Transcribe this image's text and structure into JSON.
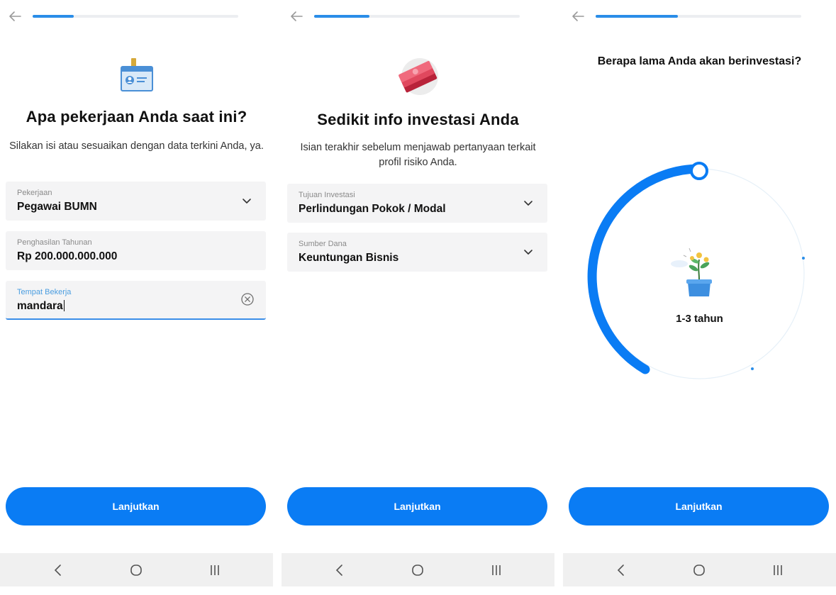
{
  "colors": {
    "accent": "#0a7cf4",
    "progress_fill": "#2a8de8",
    "progress_track": "#eceef1",
    "field_bg": "#f4f4f5",
    "navbar_bg": "#f0f0f0"
  },
  "screen1": {
    "progress": 0.2,
    "illustration": "id-card-icon",
    "title": "Apa pekerjaan Anda saat ini?",
    "subtitle": "Silakan isi atau sesuaikan dengan data terkini Anda, ya.",
    "fields": [
      {
        "label": "Pekerjaan",
        "value": "Pegawai BUMN",
        "type": "dropdown"
      },
      {
        "label": "Penghasilan Tahunan",
        "value": "Rp 200.000.000.000",
        "type": "text"
      },
      {
        "label": "Tempat Bekerja",
        "value": "mandara",
        "type": "text",
        "active": true
      }
    ],
    "cta": "Lanjutkan"
  },
  "screen2": {
    "progress": 0.27,
    "illustration": "money-stack-icon",
    "title": "Sedikit info investasi Anda",
    "subtitle": "Isian terakhir sebelum menjawab pertanyaan terkait profil risiko Anda.",
    "fields": [
      {
        "label": "Tujuan Investasi",
        "value": "Perlindungan Pokok / Modal",
        "type": "dropdown"
      },
      {
        "label": "Sumber Dana",
        "value": "Keuntungan Bisnis",
        "type": "dropdown"
      }
    ],
    "cta": "Lanjutkan"
  },
  "screen3": {
    "progress": 0.4,
    "question": "Berapa lama Anda akan berinvestasi?",
    "illustration": "plant-pot-icon",
    "selected_option": "1-3 tahun",
    "cta": "Lanjutkan"
  },
  "navbar": {
    "icons": [
      "nav-back-icon",
      "nav-home-icon",
      "nav-recents-icon"
    ]
  }
}
